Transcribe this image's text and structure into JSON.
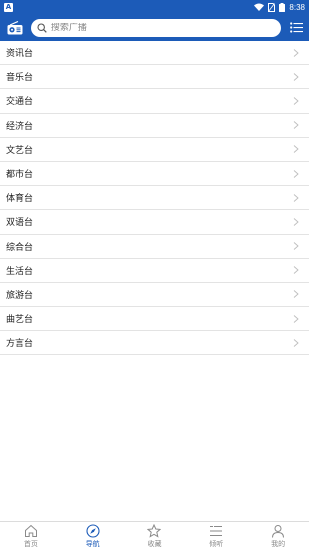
{
  "status": {
    "notification_letter": "A",
    "time": "8:38"
  },
  "search": {
    "placeholder": "搜索广播"
  },
  "stations": [
    {
      "label": "资讯台"
    },
    {
      "label": "音乐台"
    },
    {
      "label": "交通台"
    },
    {
      "label": "经济台"
    },
    {
      "label": "文艺台"
    },
    {
      "label": "都市台"
    },
    {
      "label": "体育台"
    },
    {
      "label": "双语台"
    },
    {
      "label": "综合台"
    },
    {
      "label": "生活台"
    },
    {
      "label": "旅游台"
    },
    {
      "label": "曲艺台"
    },
    {
      "label": "方言台"
    }
  ],
  "nav": {
    "home": "首页",
    "guide": "导航",
    "favorites": "收藏",
    "listen": "倾听",
    "mine": "我的",
    "active": "guide"
  },
  "colors": {
    "brand": "#1c5bb8"
  }
}
